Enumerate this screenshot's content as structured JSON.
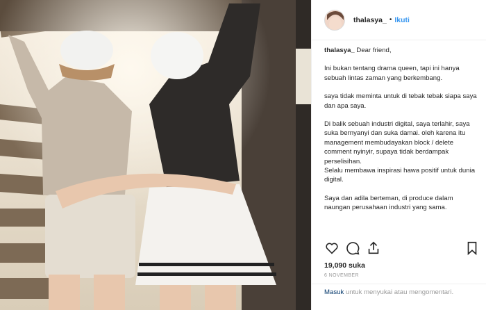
{
  "post": {
    "username": "thalasya_",
    "separator": "•",
    "follow_label": "Ikuti",
    "caption_user": "thalasya_",
    "caption_opening": "Dear friend,",
    "paragraphs": [
      "Ini bukan tentang drama queen, tapi ini hanya sebuah lintas zaman yang berkembang.",
      "saya tidak meminta untuk di tebak tebak siapa saya dan apa saya.",
      "Di balik sebuah industri digital, saya terlahir, saya suka bernyanyi dan suka damai. oleh karena itu management membudayakan block / delete comment nyinyir, supaya tidak berdampak perselisihan.\nSelalu membawa inspirasi hawa positif untuk dunia digital.",
      "Saya dan adila berteman, di produce dalam naungan perusahaan industri yang sama."
    ],
    "likes": "19,090 suka",
    "date": "6 November",
    "login_link": "Masuk",
    "login_text": " untuk menyukai atau mengomentari."
  },
  "icons": {
    "like": "heart-icon",
    "comment": "comment-icon",
    "share": "share-icon",
    "save": "bookmark-icon"
  },
  "colors": {
    "link_blue": "#3897f0",
    "text": "#262626",
    "muted": "#999999",
    "login_link": "#003569"
  }
}
